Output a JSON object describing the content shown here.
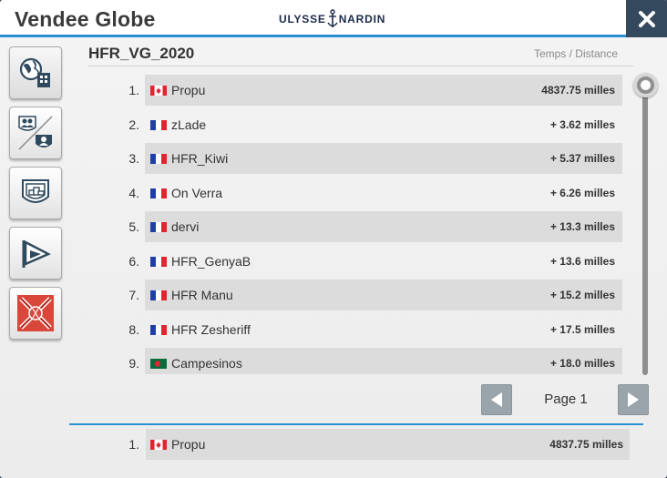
{
  "header": {
    "title": "Vendee Globe",
    "brand": {
      "left": "ULYSSE",
      "right": "NARDIN"
    }
  },
  "sidebar": {
    "tools": [
      {
        "name": "world-ranking-icon"
      },
      {
        "name": "friends-vs-team-icon"
      },
      {
        "name": "team-shield-icon"
      },
      {
        "name": "boat-flag-icon"
      },
      {
        "name": "race-emblem-icon"
      }
    ]
  },
  "ranking": {
    "race_name": "HFR_VG_2020",
    "sort_label": "Temps / Distance",
    "rows": [
      {
        "rank": "1.",
        "flag": "ca",
        "name": "Propu",
        "gap": "4837.75 milles"
      },
      {
        "rank": "2.",
        "flag": "fr",
        "name": "zLade",
        "gap": "+ 3.62 milles"
      },
      {
        "rank": "3.",
        "flag": "fr",
        "name": "HFR_Kiwi",
        "gap": "+ 5.37 milles"
      },
      {
        "rank": "4.",
        "flag": "fr",
        "name": "On Verra",
        "gap": "+ 6.26 milles"
      },
      {
        "rank": "5.",
        "flag": "fr",
        "name": "dervi",
        "gap": "+ 13.3 milles"
      },
      {
        "rank": "6.",
        "flag": "fr",
        "name": "HFR_GenyaB",
        "gap": "+ 13.6 milles"
      },
      {
        "rank": "7.",
        "flag": "fr",
        "name": "HFR Manu",
        "gap": "+ 15.2 milles"
      },
      {
        "rank": "8.",
        "flag": "fr",
        "name": "HFR Zesheriff",
        "gap": "+ 17.5 milles"
      },
      {
        "rank": "9.",
        "flag": "bd",
        "name": "Campesinos",
        "gap": "+ 18.0 milles"
      }
    ]
  },
  "pagination": {
    "label": "Page 1"
  },
  "my_rank": {
    "rank": "1.",
    "flag": "ca",
    "name": "Propu",
    "gap": "4837.75 milles"
  },
  "colors": {
    "accent": "#2a8fd1",
    "close_bg": "#34495e",
    "row_bg": "#dcdcdc"
  }
}
